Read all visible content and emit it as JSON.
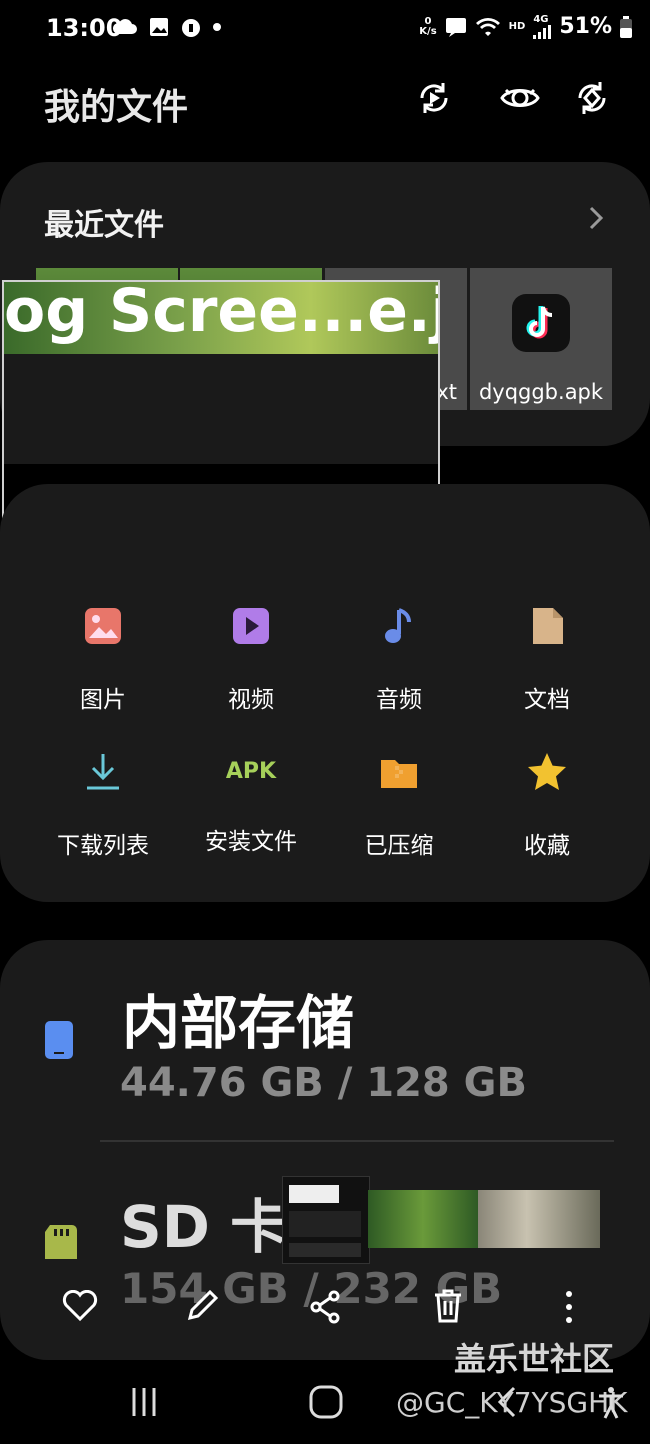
{
  "status_bar": {
    "time": "13:00",
    "speed_top": "0",
    "speed_unit": "K/s",
    "battery": "51%",
    "hd": "HD",
    "net": "4G"
  },
  "header": {
    "title": "我的文件",
    "icons": [
      "sync-icon",
      "eye-icon",
      "cloud-sync-icon"
    ]
  },
  "recent": {
    "title": "最近文件",
    "overlay_text": "og   Scree...e.j",
    "items": [
      {
        "label": ""
      },
      {
        "label": ""
      },
      {
        "label": "xt"
      },
      {
        "label": "dyqggb.apk"
      }
    ]
  },
  "categories": [
    {
      "label": "图片",
      "icon": "image-icon",
      "color": "#e8766a"
    },
    {
      "label": "视频",
      "icon": "video-icon",
      "color": "#b07ce8"
    },
    {
      "label": "音频",
      "icon": "music-icon",
      "color": "#6a8ce8"
    },
    {
      "label": "文档",
      "icon": "document-icon",
      "color": "#d8b48a"
    },
    {
      "label": "下载列表",
      "icon": "download-icon",
      "color": "#6ac8d8"
    },
    {
      "label": "安装文件",
      "icon": "apk-icon",
      "icon_text": "APK",
      "color": "#a6d05a"
    },
    {
      "label": "已压缩",
      "icon": "folder-zip-icon",
      "color": "#f0a030"
    },
    {
      "label": "收藏",
      "icon": "star-icon",
      "color": "#f2c230"
    }
  ],
  "storage": [
    {
      "name": "内部存储",
      "size": "44.76 GB / 128 GB",
      "icon": "phone-icon",
      "color": "#5a8ef0"
    },
    {
      "name": "SD 卡",
      "size": "154 GB / 232 GB",
      "icon": "sd-card-icon",
      "color": "#a8b84a"
    }
  ],
  "action_bar": [
    "favorite-icon",
    "edit-icon",
    "share-icon",
    "delete-icon",
    "more-icon"
  ],
  "watermark": {
    "line1": "盖乐世社区",
    "line2": "@GC_KY7YSGHK"
  }
}
